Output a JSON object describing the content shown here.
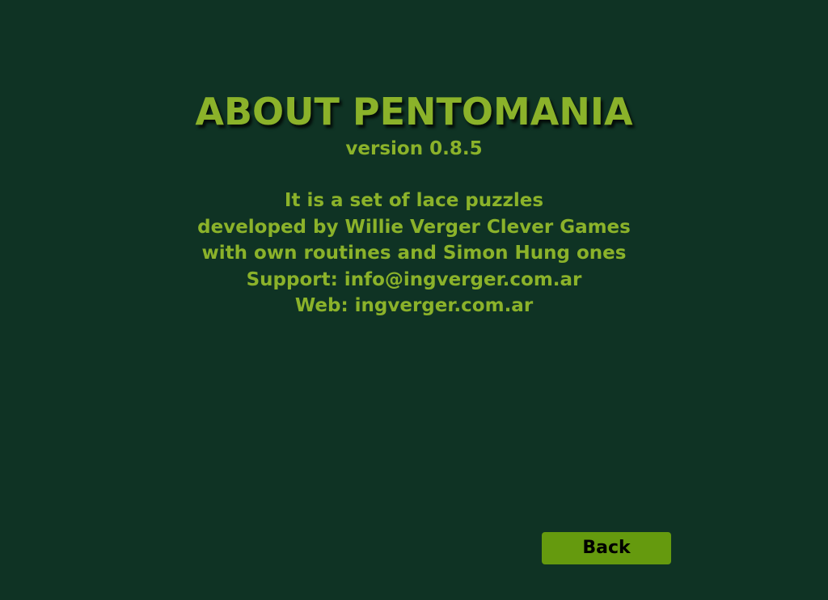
{
  "about": {
    "title": "ABOUT PENTOMANIA",
    "version": "version 0.8.5",
    "description_lines": [
      "It is a set of lace puzzles",
      "developed by Willie Verger Clever Games",
      "with own routines and Simon Hung ones",
      "Support: info@ingverger.com.ar",
      "Web: ingverger.com.ar"
    ],
    "back_label": "Back"
  },
  "colors": {
    "background": "#0f3324",
    "text_accent": "#8bb22a",
    "button_fill": "#659a0e",
    "button_text": "#000000"
  }
}
